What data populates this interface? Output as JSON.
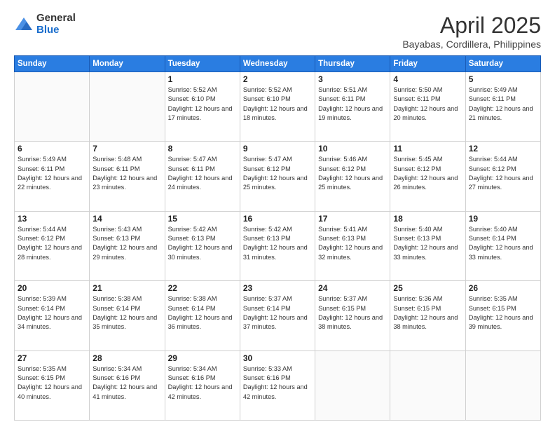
{
  "header": {
    "logo_general": "General",
    "logo_blue": "Blue",
    "title": "April 2025",
    "location": "Bayabas, Cordillera, Philippines"
  },
  "days_of_week": [
    "Sunday",
    "Monday",
    "Tuesday",
    "Wednesday",
    "Thursday",
    "Friday",
    "Saturday"
  ],
  "weeks": [
    [
      {
        "day": "",
        "info": ""
      },
      {
        "day": "",
        "info": ""
      },
      {
        "day": "1",
        "info": "Sunrise: 5:52 AM\nSunset: 6:10 PM\nDaylight: 12 hours and 17 minutes."
      },
      {
        "day": "2",
        "info": "Sunrise: 5:52 AM\nSunset: 6:10 PM\nDaylight: 12 hours and 18 minutes."
      },
      {
        "day": "3",
        "info": "Sunrise: 5:51 AM\nSunset: 6:11 PM\nDaylight: 12 hours and 19 minutes."
      },
      {
        "day": "4",
        "info": "Sunrise: 5:50 AM\nSunset: 6:11 PM\nDaylight: 12 hours and 20 minutes."
      },
      {
        "day": "5",
        "info": "Sunrise: 5:49 AM\nSunset: 6:11 PM\nDaylight: 12 hours and 21 minutes."
      }
    ],
    [
      {
        "day": "6",
        "info": "Sunrise: 5:49 AM\nSunset: 6:11 PM\nDaylight: 12 hours and 22 minutes."
      },
      {
        "day": "7",
        "info": "Sunrise: 5:48 AM\nSunset: 6:11 PM\nDaylight: 12 hours and 23 minutes."
      },
      {
        "day": "8",
        "info": "Sunrise: 5:47 AM\nSunset: 6:11 PM\nDaylight: 12 hours and 24 minutes."
      },
      {
        "day": "9",
        "info": "Sunrise: 5:47 AM\nSunset: 6:12 PM\nDaylight: 12 hours and 25 minutes."
      },
      {
        "day": "10",
        "info": "Sunrise: 5:46 AM\nSunset: 6:12 PM\nDaylight: 12 hours and 25 minutes."
      },
      {
        "day": "11",
        "info": "Sunrise: 5:45 AM\nSunset: 6:12 PM\nDaylight: 12 hours and 26 minutes."
      },
      {
        "day": "12",
        "info": "Sunrise: 5:44 AM\nSunset: 6:12 PM\nDaylight: 12 hours and 27 minutes."
      }
    ],
    [
      {
        "day": "13",
        "info": "Sunrise: 5:44 AM\nSunset: 6:12 PM\nDaylight: 12 hours and 28 minutes."
      },
      {
        "day": "14",
        "info": "Sunrise: 5:43 AM\nSunset: 6:13 PM\nDaylight: 12 hours and 29 minutes."
      },
      {
        "day": "15",
        "info": "Sunrise: 5:42 AM\nSunset: 6:13 PM\nDaylight: 12 hours and 30 minutes."
      },
      {
        "day": "16",
        "info": "Sunrise: 5:42 AM\nSunset: 6:13 PM\nDaylight: 12 hours and 31 minutes."
      },
      {
        "day": "17",
        "info": "Sunrise: 5:41 AM\nSunset: 6:13 PM\nDaylight: 12 hours and 32 minutes."
      },
      {
        "day": "18",
        "info": "Sunrise: 5:40 AM\nSunset: 6:13 PM\nDaylight: 12 hours and 33 minutes."
      },
      {
        "day": "19",
        "info": "Sunrise: 5:40 AM\nSunset: 6:14 PM\nDaylight: 12 hours and 33 minutes."
      }
    ],
    [
      {
        "day": "20",
        "info": "Sunrise: 5:39 AM\nSunset: 6:14 PM\nDaylight: 12 hours and 34 minutes."
      },
      {
        "day": "21",
        "info": "Sunrise: 5:38 AM\nSunset: 6:14 PM\nDaylight: 12 hours and 35 minutes."
      },
      {
        "day": "22",
        "info": "Sunrise: 5:38 AM\nSunset: 6:14 PM\nDaylight: 12 hours and 36 minutes."
      },
      {
        "day": "23",
        "info": "Sunrise: 5:37 AM\nSunset: 6:14 PM\nDaylight: 12 hours and 37 minutes."
      },
      {
        "day": "24",
        "info": "Sunrise: 5:37 AM\nSunset: 6:15 PM\nDaylight: 12 hours and 38 minutes."
      },
      {
        "day": "25",
        "info": "Sunrise: 5:36 AM\nSunset: 6:15 PM\nDaylight: 12 hours and 38 minutes."
      },
      {
        "day": "26",
        "info": "Sunrise: 5:35 AM\nSunset: 6:15 PM\nDaylight: 12 hours and 39 minutes."
      }
    ],
    [
      {
        "day": "27",
        "info": "Sunrise: 5:35 AM\nSunset: 6:15 PM\nDaylight: 12 hours and 40 minutes."
      },
      {
        "day": "28",
        "info": "Sunrise: 5:34 AM\nSunset: 6:16 PM\nDaylight: 12 hours and 41 minutes."
      },
      {
        "day": "29",
        "info": "Sunrise: 5:34 AM\nSunset: 6:16 PM\nDaylight: 12 hours and 42 minutes."
      },
      {
        "day": "30",
        "info": "Sunrise: 5:33 AM\nSunset: 6:16 PM\nDaylight: 12 hours and 42 minutes."
      },
      {
        "day": "",
        "info": ""
      },
      {
        "day": "",
        "info": ""
      },
      {
        "day": "",
        "info": ""
      }
    ]
  ]
}
